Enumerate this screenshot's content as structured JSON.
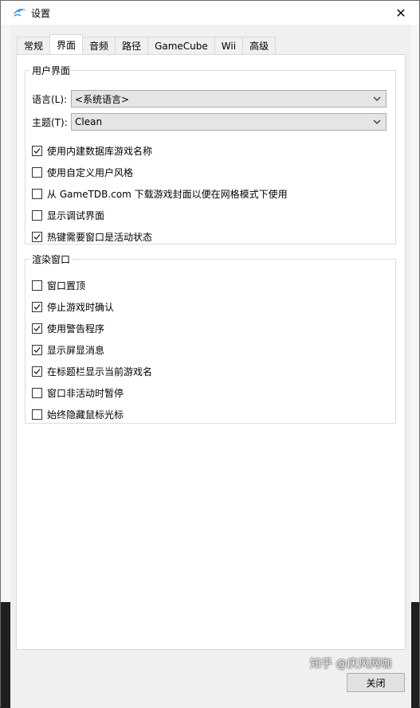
{
  "window": {
    "title": "设置",
    "close_glyph": "✕"
  },
  "tabs": [
    {
      "label": "常规",
      "active": false
    },
    {
      "label": "界面",
      "active": true
    },
    {
      "label": "音频",
      "active": false
    },
    {
      "label": "路径",
      "active": false
    },
    {
      "label": "GameCube",
      "active": false
    },
    {
      "label": "Wii",
      "active": false
    },
    {
      "label": "高级",
      "active": false
    }
  ],
  "ui_group": {
    "legend": "用户界面",
    "language": {
      "label": "语言(L):",
      "value": "<系统语言>"
    },
    "theme": {
      "label": "主题(T):",
      "value": "Clean"
    },
    "checkboxes": [
      {
        "label": "使用内建数据库游戏名称",
        "checked": true
      },
      {
        "label": "使用自定义用户风格",
        "checked": false
      },
      {
        "label": "从 GameTDB.com 下载游戏封面以便在网格模式下使用",
        "checked": false
      },
      {
        "label": "显示调试界面",
        "checked": false
      },
      {
        "label": "热键需要窗口是活动状态",
        "checked": true
      }
    ]
  },
  "render_group": {
    "legend": "渲染窗口",
    "checkboxes": [
      {
        "label": "窗口置顶",
        "checked": false
      },
      {
        "label": "停止游戏时确认",
        "checked": true
      },
      {
        "label": "使用警告程序",
        "checked": true
      },
      {
        "label": "显示屏显消息",
        "checked": true
      },
      {
        "label": "在标题栏显示当前游戏名",
        "checked": true
      },
      {
        "label": "窗口非活动时暂停",
        "checked": false
      },
      {
        "label": "始终隐藏鼠标光标",
        "checked": false
      }
    ]
  },
  "footer": {
    "close_label": "关闭"
  },
  "watermark": "知乎 @庆风网咖",
  "colors": {
    "panel_bg": "#ffffff",
    "window_bg": "#f0f0f0",
    "dolphin_blue": "#3a9bd8"
  }
}
